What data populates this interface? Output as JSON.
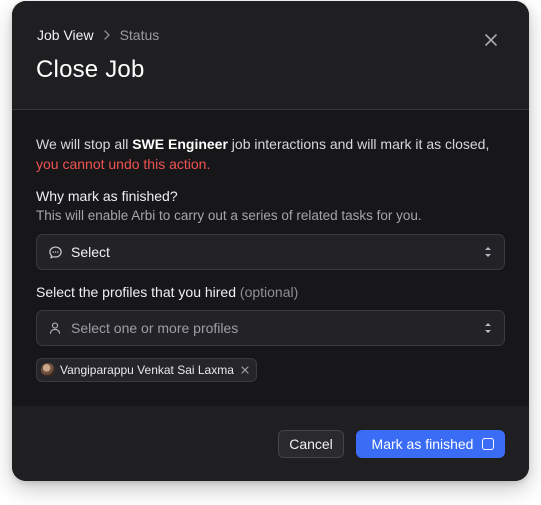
{
  "header": {
    "breadcrumb": {
      "parent": "Job View",
      "current": "Status"
    },
    "title": "Close Job"
  },
  "body": {
    "description": {
      "prefix": "We will stop all ",
      "job_name": "SWE Engineer",
      "middle": " job interactions and will mark it as closed, ",
      "warning": "you cannot undo this action."
    },
    "reason": {
      "label": "Why mark as finished?",
      "hint": "This will enable Arbi to carry out a series of related tasks for you.",
      "value": "Select"
    },
    "profiles": {
      "label": "Select the profiles that you hired",
      "optional": "(optional)",
      "placeholder": "Select one or more profiles",
      "selected": [
        {
          "name": "Vangiparappu Venkat Sai Laxma"
        }
      ]
    }
  },
  "footer": {
    "cancel_label": "Cancel",
    "confirm_label": "Mark as finished"
  },
  "colors": {
    "primary": "#3b6cf6",
    "danger": "#f05252",
    "surface": "#1d1d20"
  }
}
